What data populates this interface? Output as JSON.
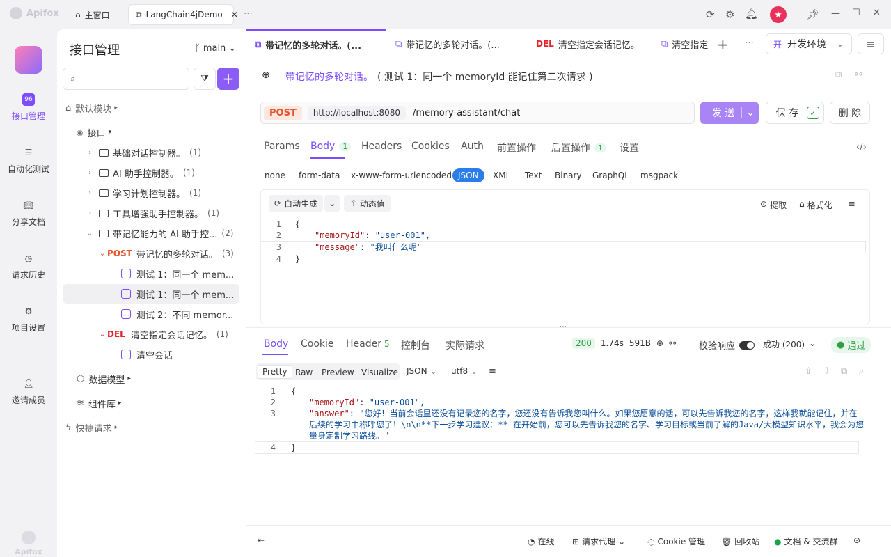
{
  "app": {
    "name": "Apifox"
  },
  "window_tabs": [
    {
      "label": "主窗口"
    },
    {
      "label": "LangChain4jDemo"
    }
  ],
  "leftnav": {
    "items": [
      {
        "label": "接口管理"
      },
      {
        "label": "自动化测试"
      },
      {
        "label": "分享文档"
      },
      {
        "label": "请求历史"
      },
      {
        "label": "项目设置"
      },
      {
        "label": "邀请成员"
      }
    ],
    "bottom_logo": "Apifox"
  },
  "sidebar": {
    "title": "接口管理",
    "branch": "main",
    "search_placeholder": "",
    "tree": [
      {
        "label": "默认模块"
      },
      {
        "label": "接口"
      },
      {
        "label": "基础对话控制器。",
        "count": "(1)"
      },
      {
        "label": "AI 助手控制器。",
        "count": "(1)"
      },
      {
        "label": "学习计划控制器。",
        "count": "(1)"
      },
      {
        "label": "工具增强助手控制器。",
        "count": "(1)"
      },
      {
        "label": "带记忆能力的 AI 助手控...",
        "count": "(2)"
      },
      {
        "method": "POST",
        "label": "带记忆的多轮对话。",
        "count": "(3)"
      },
      {
        "label": "测试 1：同一个 mem..."
      },
      {
        "label": "测试 1：同一个 mem..."
      },
      {
        "label": "测试 2：不同 memor..."
      },
      {
        "method": "DEL",
        "label": "清空指定会话记忆。",
        "count": "(1)"
      },
      {
        "label": "清空会话"
      },
      {
        "label": "数据模型"
      },
      {
        "label": "组件库"
      },
      {
        "label": "快捷请求"
      }
    ]
  },
  "request_tabs": [
    {
      "label": "带记忆的多轮对话。(..."
    },
    {
      "label": "带记忆的多轮对话。(..."
    },
    {
      "method": "DEL",
      "label": "清空指定会话记忆。"
    },
    {
      "label": "清空指定"
    }
  ],
  "env": {
    "badge": "开",
    "label": "开发环境"
  },
  "request": {
    "name": "带记忆的多轮对话。",
    "case": "( 测试 1：同一个 memoryId 能记住第二次请求 )",
    "method": "POST",
    "base_url": "http://localhost:8080",
    "path": "/memory-assistant/chat",
    "send_label": "发 送",
    "save_label": "保 存",
    "delete_label": "删 除"
  },
  "param_tabs": [
    {
      "label": "Params"
    },
    {
      "label": "Body",
      "badge": "1"
    },
    {
      "label": "Headers"
    },
    {
      "label": "Cookies"
    },
    {
      "label": "Auth"
    },
    {
      "label": "前置操作"
    },
    {
      "label": "后置操作",
      "badge": "1"
    },
    {
      "label": "设置"
    }
  ],
  "body_types": [
    "none",
    "form-data",
    "x-www-form-urlencoded",
    "JSON",
    "XML",
    "Text",
    "Binary",
    "GraphQL",
    "msgpack"
  ],
  "editor_tools": {
    "auto": "自动生成",
    "dynamic": "动态值",
    "extract": "提取",
    "format": "格式化"
  },
  "request_body": [
    {
      "n": "1",
      "text": "{"
    },
    {
      "n": "2",
      "key": "\"memoryId\"",
      "val": "\"user-001\","
    },
    {
      "n": "3",
      "key": "\"message\"",
      "val": "\"我叫什么呢\""
    },
    {
      "n": "4",
      "text": "}"
    }
  ],
  "response_tabs": [
    {
      "label": "Body"
    },
    {
      "label": "Cookie"
    },
    {
      "label": "Header",
      "badge": "5"
    },
    {
      "label": "控制台"
    },
    {
      "label": "实际请求"
    }
  ],
  "response_meta": {
    "status": "200",
    "time": "1.74s",
    "size": "591B",
    "validate": "校验响应",
    "result": "成功 (200)",
    "pass": "通过"
  },
  "response_formats": [
    "Pretty",
    "Raw",
    "Preview",
    "Visualize"
  ],
  "response_lang": "JSON",
  "response_encoding": "utf8",
  "response_body": [
    {
      "n": "1",
      "text": "{"
    },
    {
      "n": "2",
      "key": "\"memoryId\"",
      "val": "\"user-001\","
    },
    {
      "n": "3",
      "key": "\"answer\"",
      "val": "\"您好！当前会话里还没有记录您的名字，您还没有告诉我您叫什么。如果您愿意的话，可以先告诉我您的名字，这样我就能记住，并在"
    },
    {
      "n": "",
      "val": "后续的学习中称呼您了！\\n\\n**下一步学习建议：** 在开始前，您可以先告诉我您的名字、学习目标或当前了解的Java/大模型知识水平，我会为您"
    },
    {
      "n": "",
      "val": "量身定制学习路线。\""
    },
    {
      "n": "4",
      "text": "}"
    }
  ],
  "footer": {
    "online": "在线",
    "proxy": "请求代理",
    "cookie": "Cookie 管理",
    "recycle": "回收站",
    "docs": "文档 & 交流群"
  }
}
